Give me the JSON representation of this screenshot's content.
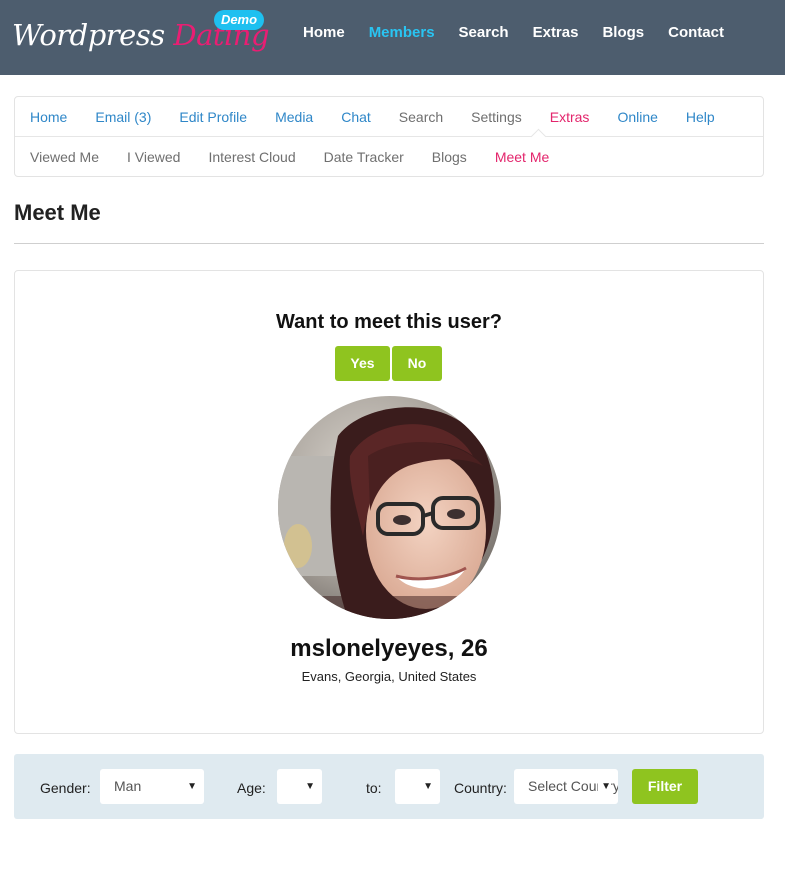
{
  "logo": {
    "main": "Wordpress",
    "accent": "Dating",
    "badge": "Demo"
  },
  "top_nav": [
    {
      "label": "Home",
      "active": false
    },
    {
      "label": "Members",
      "active": true
    },
    {
      "label": "Search",
      "active": false
    },
    {
      "label": "Extras",
      "active": false
    },
    {
      "label": "Blogs",
      "active": false
    },
    {
      "label": "Contact",
      "active": false
    }
  ],
  "subnav": {
    "row1": [
      "Home",
      "Email (3)",
      "Edit Profile",
      "Media",
      "Chat",
      "Search",
      "Settings",
      "Extras",
      "Online",
      "Help"
    ],
    "row2": [
      "Viewed Me",
      "I Viewed",
      "Interest Cloud",
      "Date Tracker",
      "Blogs",
      "Meet Me"
    ],
    "active_row1": "Extras",
    "active_row2": "Meet Me"
  },
  "page": {
    "title": "Meet Me"
  },
  "meet": {
    "question": "Want to meet this user?",
    "yes_label": "Yes",
    "no_label": "No",
    "user_name": "mslonelyeyes, 26",
    "location": "Evans, Georgia, United States"
  },
  "filter": {
    "gender_label": "Gender:",
    "gender_value": "Man",
    "age_label": "Age:",
    "age_from_value": "",
    "to_label": "to:",
    "age_to_value": "",
    "country_label": "Country:",
    "country_value": "Select Country",
    "filter_button": "Filter"
  },
  "colors": {
    "header_bg": "#4d5d6e",
    "nav_active": "#29c4f2",
    "brand_pink": "#e91e73",
    "badge_blue": "#1ec0f0",
    "link_blue": "#2f87c8",
    "button_green": "#8fc41f",
    "filter_bg": "#dfeaf0"
  },
  "icons": {
    "select_arrow": "chevron-down-icon"
  }
}
